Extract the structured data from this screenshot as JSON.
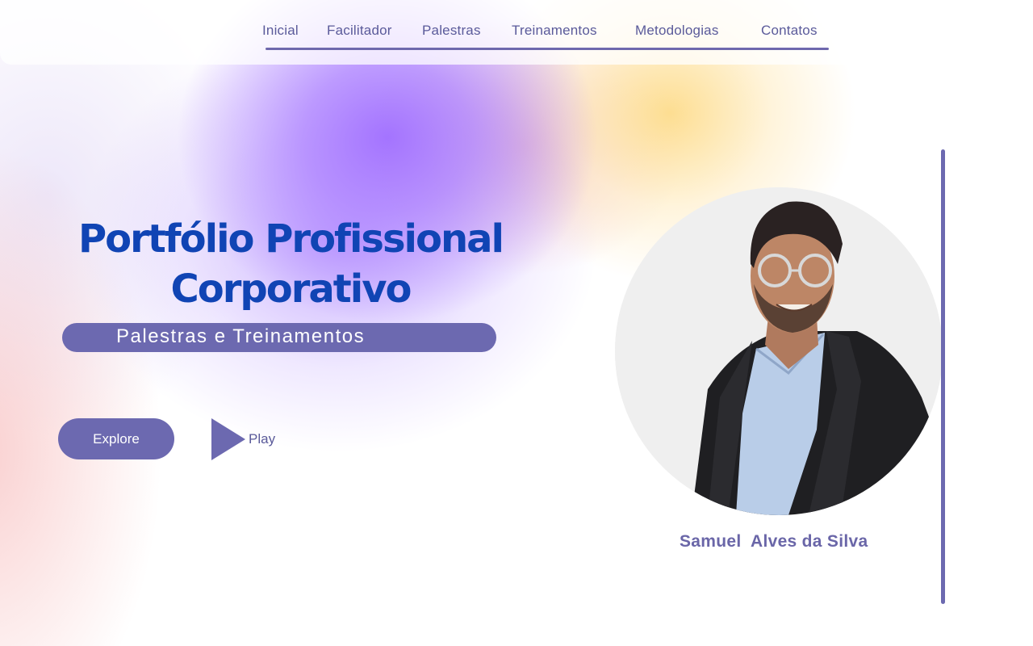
{
  "nav": {
    "items": [
      {
        "label": "Inicial"
      },
      {
        "label": "Facilitador"
      },
      {
        "label": "Palestras"
      },
      {
        "label": "Treinamentos"
      },
      {
        "label": "Metodologias"
      },
      {
        "label": "Contatos"
      }
    ]
  },
  "hero": {
    "title_line1": "Portfólio Profissional",
    "title_line2": "Corporativo",
    "subtitle": "Palestras e Treinamentos",
    "explore_label": "Explore",
    "play_label": "Play"
  },
  "profile": {
    "name": "Samuel  Alves da Silva"
  },
  "colors": {
    "accent": "#6c69b0",
    "title": "#1044b4",
    "nav_text": "#5a5a9a"
  },
  "icons": {
    "play": "play-triangle-icon"
  }
}
